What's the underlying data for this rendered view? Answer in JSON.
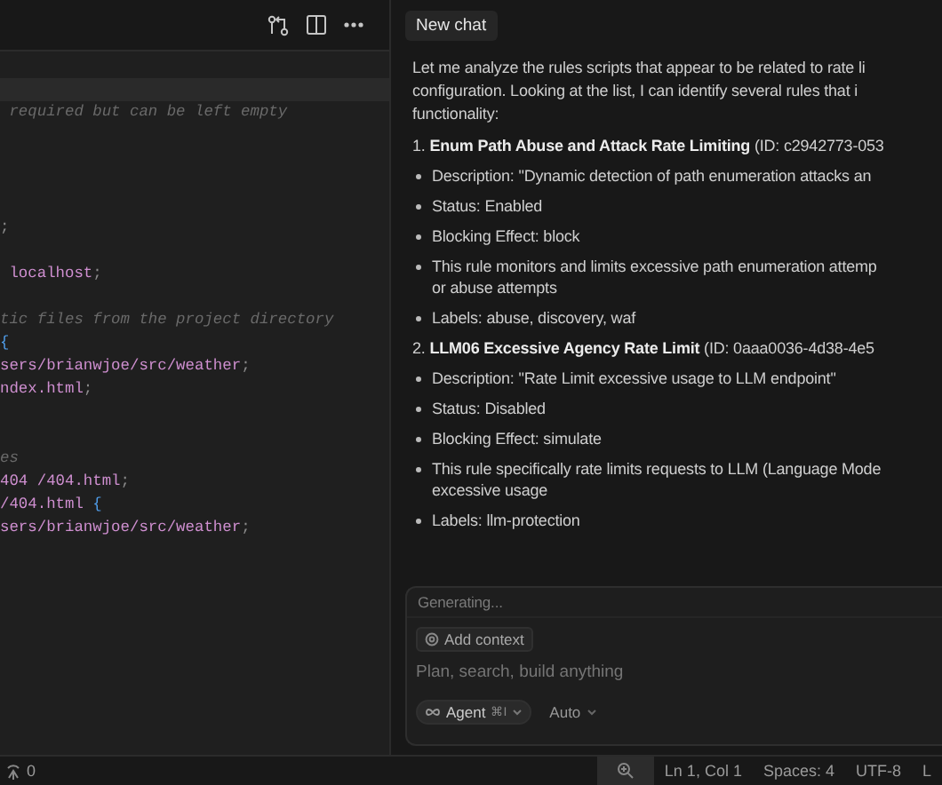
{
  "editor": {
    "lines": [
      {
        "kind": "blank",
        "current": true
      },
      {
        "kind": "code",
        "tokens": [
          {
            "text": " required but can be left empty",
            "kind": "comment"
          }
        ]
      },
      {
        "kind": "blank"
      },
      {
        "kind": "blank"
      },
      {
        "kind": "blank"
      },
      {
        "kind": "blank"
      },
      {
        "kind": "code",
        "tokens": [
          {
            "text": ";",
            "kind": "punct"
          }
        ]
      },
      {
        "kind": "blank"
      },
      {
        "kind": "code",
        "tokens": [
          {
            "text": " localhost",
            "kind": "string"
          },
          {
            "text": ";",
            "kind": "punct"
          }
        ]
      },
      {
        "kind": "blank"
      },
      {
        "kind": "code",
        "tokens": [
          {
            "text": "tic files from the project directory",
            "kind": "comment"
          }
        ]
      },
      {
        "kind": "code",
        "tokens": [
          {
            "text": "{",
            "kind": "brace"
          }
        ]
      },
      {
        "kind": "code",
        "tokens": [
          {
            "text": "sers/brianwjoe/src/weather",
            "kind": "string"
          },
          {
            "text": ";",
            "kind": "punct"
          }
        ]
      },
      {
        "kind": "code",
        "tokens": [
          {
            "text": "ndex.html",
            "kind": "string"
          },
          {
            "text": ";",
            "kind": "punct"
          }
        ]
      },
      {
        "kind": "blank"
      },
      {
        "kind": "blank"
      },
      {
        "kind": "code",
        "tokens": [
          {
            "text": "es",
            "kind": "comment"
          }
        ]
      },
      {
        "kind": "code",
        "tokens": [
          {
            "text": "404 /404.html",
            "kind": "string"
          },
          {
            "text": ";",
            "kind": "punct"
          }
        ]
      },
      {
        "kind": "code",
        "tokens": [
          {
            "text": "/404.html ",
            "kind": "string"
          },
          {
            "text": "{",
            "kind": "brace"
          }
        ]
      },
      {
        "kind": "code",
        "tokens": [
          {
            "text": "sers/brianwjoe/src/weather",
            "kind": "string"
          },
          {
            "text": ";",
            "kind": "punct"
          }
        ]
      }
    ]
  },
  "chat": {
    "tab": "New chat",
    "intro": [
      "Let me analyze the rules scripts that appear to be related to rate li",
      "configuration. Looking at the list, I can identify several rules that i",
      "functionality:"
    ],
    "rules": [
      {
        "heading": "1. **Enum Path Abuse and Attack Rate Limiting** (ID: c2942773-053",
        "bullets": [
          "Description: \"Dynamic detection of path enumeration attacks an",
          "Status: Enabled",
          "Blocking Effect: block",
          "This rule monitors and limits excessive path enumeration attemp\nor abuse attempts",
          "Labels: abuse, discovery, waf"
        ]
      },
      {
        "heading": "2. **LLM06 Excessive Agency Rate Limit** (ID: 0aaa0036-4d38-4e5",
        "bullets": [
          "Description: \"Rate Limit excessive usage to LLM endpoint\"",
          "Status: Disabled",
          "Blocking Effect: simulate",
          "This rule specifically rate limits requests to LLM (Language Mode\nexcessive usage",
          "Labels: llm-protection"
        ]
      }
    ],
    "composer": {
      "status": "Generating...",
      "context_button": "Add context",
      "placeholder": "Plan, search, build anything",
      "mode": "Agent",
      "mode_shortcut": "⌘I",
      "model": "Auto"
    }
  },
  "status_bar": {
    "ports": "0",
    "items": [
      "Ln 1, Col 1",
      "Spaces: 4",
      "UTF-8",
      "L"
    ]
  }
}
